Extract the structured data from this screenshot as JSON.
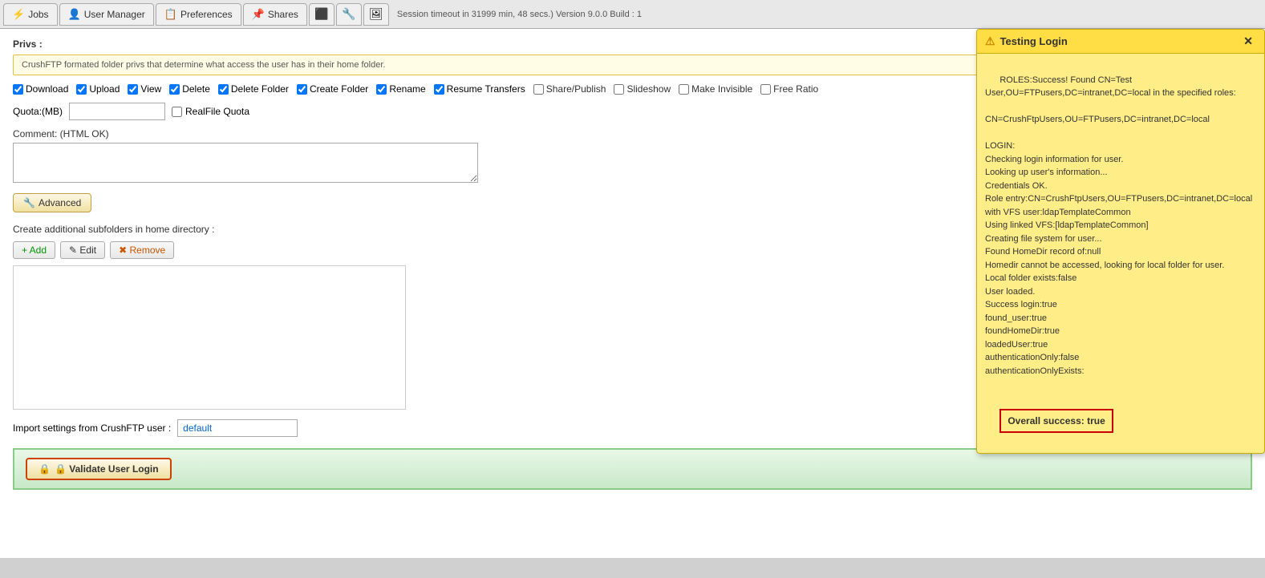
{
  "nav": {
    "tabs": [
      {
        "id": "jobs",
        "label": "Jobs",
        "icon": "⚡"
      },
      {
        "id": "user-manager",
        "label": "User Manager",
        "icon": "👤"
      },
      {
        "id": "preferences",
        "label": "Preferences",
        "icon": "📋"
      },
      {
        "id": "shares",
        "label": "Shares",
        "icon": "📌"
      },
      {
        "id": "icon1",
        "icon": "⬛"
      },
      {
        "id": "icon2",
        "icon": "🔧"
      },
      {
        "id": "icon3",
        "icon": "🖼"
      }
    ],
    "session_info": "Session timeout in 31999 min, 48 secs.)  Version 9.0.0 Build : 1"
  },
  "privs": {
    "label": "Privs :",
    "info_text": "CrushFTP formated folder privs that determine what access the user has in their home folder.",
    "checkboxes": [
      {
        "id": "download",
        "label": "Download",
        "checked": true
      },
      {
        "id": "upload",
        "label": "Upload",
        "checked": true
      },
      {
        "id": "view",
        "label": "View",
        "checked": true
      },
      {
        "id": "delete",
        "label": "Delete",
        "checked": true
      },
      {
        "id": "delete-folder",
        "label": "Delete Folder",
        "checked": true
      },
      {
        "id": "create-folder",
        "label": "Create Folder",
        "checked": true
      },
      {
        "id": "rename",
        "label": "Rename",
        "checked": true
      },
      {
        "id": "resume-transfers",
        "label": "Resume Transfers",
        "checked": true
      },
      {
        "id": "share-publish",
        "label": "Share/Publish",
        "checked": false
      },
      {
        "id": "slideshow",
        "label": "Slideshow",
        "checked": false
      },
      {
        "id": "make-invisible",
        "label": "Make Invisible",
        "checked": false
      },
      {
        "id": "free-ratio",
        "label": "Free Ratio",
        "checked": false
      }
    ]
  },
  "quota": {
    "label": "Quota:(MB)",
    "value": "",
    "realfile_label": "RealFile Quota"
  },
  "comment": {
    "label": "Comment: (HTML OK)",
    "value": ""
  },
  "advanced": {
    "label": "Advanced"
  },
  "subfolders": {
    "label": "Create additional subfolders in home directory :",
    "add_label": "+ Add",
    "edit_label": "✎ Edit",
    "remove_label": "✖ Remove"
  },
  "import": {
    "label": "Import settings from CrushFTP user :",
    "value": "default"
  },
  "validate": {
    "label": "🔒 Validate User Login"
  },
  "testing_popup": {
    "title": "Testing Login",
    "close_label": "✕",
    "body_text": "ROLES:Success! Found CN=Test User,OU=FTPusers,DC=intranet,DC=local in the specified roles:\n\nCN=CrushFtpUsers,OU=FTPusers,DC=intranet,DC=local\n\nLOGIN:\nChecking login information for user.\nLooking up user's information...\nCredentials OK.\nRole entry:CN=CrushFtpUsers,OU=FTPusers,DC=intranet,DC=local with VFS user:ldapTemplateCommon\nUsing linked VFS:[ldapTemplateCommon]\nCreating file system for user...\nFound HomeDir record of:null\nHomedir cannot be accessed, looking for local folder for user.\nLocal folder exists:false\nUser loaded.\nSuccess login:true\nfound_user:true\nfoundHomeDir:true\nloadedUser:true\nauthenticationOnly:false\nauthenticationOnlyExists:",
    "overall_success": "Overall success: true"
  }
}
